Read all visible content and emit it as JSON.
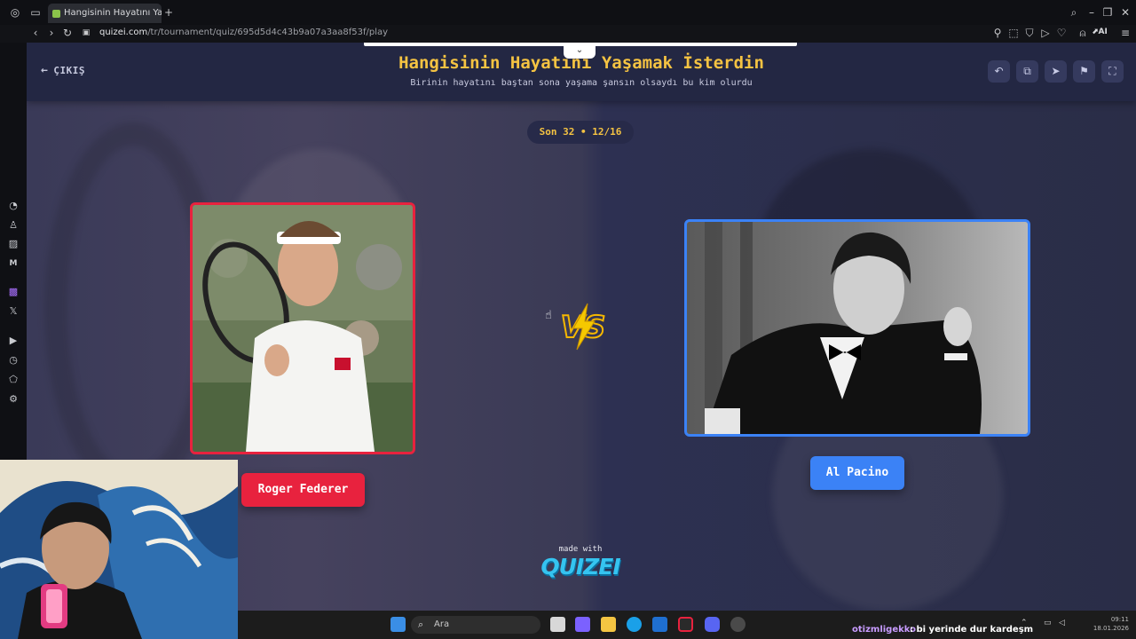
{
  "browser": {
    "tab_title": "Hangisinin Hayatını Yaşam",
    "url_host": "quizei.com",
    "url_path": "/tr/tournament/quiz/695d5d4c43b9a07a3aa8f53f/play",
    "ai_label": "AI"
  },
  "header": {
    "exit_label": "ÇIKIŞ",
    "title": "Hangisinin Hayatını Yaşamak İsterdin",
    "subtitle": "Birinin hayatını baştan sona yaşama şansın olsaydı bu kim olurdu",
    "buttons": [
      "undo-icon",
      "share-icon",
      "send-icon",
      "flag-icon",
      "fullscreen-icon"
    ]
  },
  "round": {
    "label": "Son 32 • 12/16"
  },
  "candidates": {
    "left": {
      "name": "Roger Federer",
      "accent": "#e8223e"
    },
    "right": {
      "name": "Al Pacino",
      "accent": "#3b82f6"
    }
  },
  "vs_label": "VS",
  "branding": {
    "made_with": "made with",
    "logo": "QUIZEI"
  },
  "taskbar": {
    "search_placeholder": "Ara",
    "chat_user": "otizmligekko",
    "chat_message": ": bi yerinde dur kardeşm",
    "clock_time": "09:11",
    "clock_date": "18.01.2026"
  },
  "colors": {
    "title": "#f5c342",
    "header_bg": "#232743",
    "quizei_blue": "#35c4f0"
  }
}
